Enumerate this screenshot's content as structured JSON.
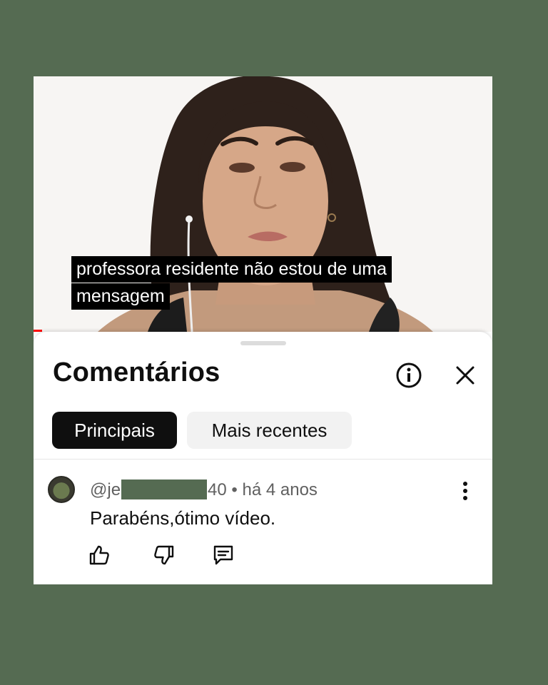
{
  "video": {
    "caption_line_1": "professora residente não estou de uma",
    "caption_line_2": "mensagem"
  },
  "comments_panel": {
    "title": "Comentários",
    "info_icon": "info-circle-icon",
    "close_icon": "close-icon",
    "filters": [
      {
        "label": "Principais",
        "selected": true
      },
      {
        "label": "Mais recentes",
        "selected": false
      }
    ],
    "comments": [
      {
        "author_prefix": "@je",
        "author_suffix": "40",
        "separator": "•",
        "time": "há 4 anos",
        "text": "Parabéns,ótimo vídeo.",
        "actions": [
          "thumbs-up-icon",
          "thumbs-down-icon",
          "reply-icon"
        ]
      }
    ]
  },
  "colors": {
    "background": "#556b52",
    "chip_active": "#0f0f0f",
    "chip_inactive": "#f2f2f2",
    "progress": "#ff0000"
  }
}
